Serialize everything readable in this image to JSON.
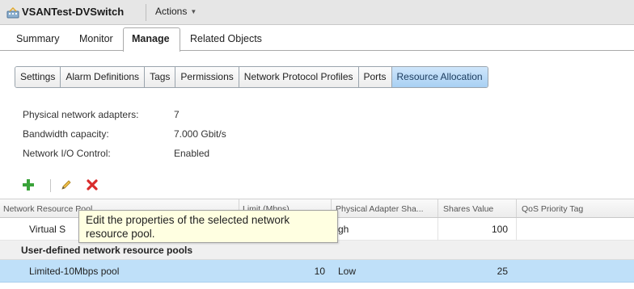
{
  "header": {
    "title": "VSANTest-DVSwitch",
    "actions_label": "Actions",
    "app_icon": "distributed-switch-icon"
  },
  "top_tabs": [
    "Summary",
    "Monitor",
    "Manage",
    "Related Objects"
  ],
  "top_tabs_active": "Manage",
  "sub_tabs": [
    "Settings",
    "Alarm Definitions",
    "Tags",
    "Permissions",
    "Network Protocol Profiles",
    "Ports",
    "Resource Allocation"
  ],
  "sub_tabs_active": "Resource Allocation",
  "properties": [
    {
      "label": "Physical network adapters:",
      "value": "7"
    },
    {
      "label": "Bandwidth capacity:",
      "value": "7.000 Gbit/s"
    },
    {
      "label": "Network I/O Control:",
      "value": "Enabled"
    }
  ],
  "toolbar": {
    "add_icon": "plus-icon",
    "edit_icon": "pencil-icon",
    "delete_icon": "x-icon"
  },
  "table": {
    "columns": [
      "Network Resource Pool",
      "Limit (Mbps)",
      "Physical Adapter Sha...",
      "Shares Value",
      "QoS Priority Tag"
    ],
    "system_row": {
      "pool": "Virtual S",
      "limit": "",
      "shares": "gh",
      "value": "100",
      "qos": ""
    },
    "group_header": "User-defined network resource pools",
    "user_rows": [
      {
        "pool": "Limited-10Mbps pool",
        "limit": "10",
        "shares": "Low",
        "value": "25",
        "qos": ""
      }
    ]
  },
  "tooltip": {
    "line1": "Edit the properties of the selected network",
    "line2": "resource pool."
  },
  "colors": {
    "selected_row": "#bfe0f9",
    "active_subtab": "#b7d9f6",
    "tooltip_bg": "#ffffe1",
    "add_green": "#3aa33a",
    "delete_red": "#d92b2b"
  }
}
